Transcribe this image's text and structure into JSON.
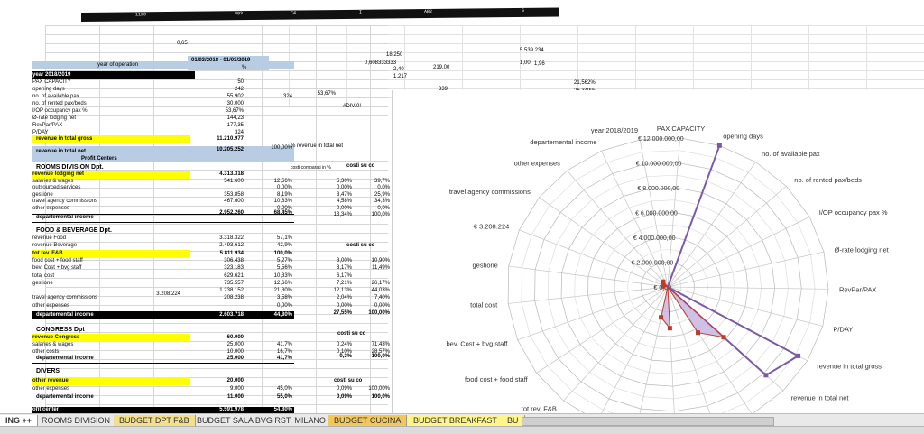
{
  "column_headers": [
    "1120",
    "893",
    "C4",
    "I",
    "",
    "",
    "AB2",
    "",
    "",
    "S"
  ],
  "top_cells": {
    "c1": "0,65",
    "c2": "18.250",
    "c3": "0,608333333",
    "c4": "2,40",
    "c5": "219,00",
    "c6": "1,00",
    "c7": "1,96",
    "c8": "1,217",
    "c9": "5.539.234",
    "c10": "339",
    "c11": "21,562%",
    "c12": "26,349%"
  },
  "header": {
    "year_of_operation": "year of operation",
    "period": "01/03/2018 - 01/03/2019",
    "pct": "%"
  },
  "kpi_rows": [
    {
      "label": "year 2018/2019",
      "v1": "",
      "v2": ""
    },
    {
      "label": "PAX CAPACITY",
      "v1": "50",
      "v2": ""
    },
    {
      "label": "opening days",
      "v1": "242",
      "v2": ""
    },
    {
      "label": "no. of available pax",
      "v1": "55.902",
      "v2": "324"
    },
    {
      "label": "no. of rented pax/beds",
      "v1": "30.000",
      "v2": ""
    },
    {
      "label": "I/OP occupancy pax %",
      "v1": "53,67%",
      "v2": ""
    },
    {
      "label": "Ø-rate lodging net",
      "v1": "144,23",
      "v2": ""
    },
    {
      "label": "RevPar/PAX",
      "v1": "177,35",
      "v2": ""
    },
    {
      "label": "P/DAY",
      "v1": "324",
      "v2": ""
    }
  ],
  "side_value_a": "53,67%",
  "side_value_b": "#DIV/0!",
  "revenue_gross": {
    "label": "revenue in total gross",
    "value": "11.210.977"
  },
  "revenue_net": {
    "label": "revenue in total net",
    "value": "10.205.252",
    "pct": "100,00%",
    "note": "% revenue in total net"
  },
  "profit_centers_label": "Profit Centers",
  "rooms": {
    "title": "ROOMS DIVISION Dpt.",
    "col_head_a": "costi comparati in %",
    "col_head_b": "costi su co",
    "rows": [
      {
        "label": "revenue lodging net",
        "v1": "4.313.318",
        "v2": "",
        "v3": "",
        "v4": "",
        "highlight": true
      },
      {
        "label": "salaries & wages",
        "v1": "541.600",
        "v2": "12,56%",
        "v3": "5,30%",
        "v4": "39,7%"
      },
      {
        "label": "outsourced services",
        "v1": "",
        "v2": "0,00%",
        "v3": "0,00%",
        "v4": "0,0%"
      },
      {
        "label": "gestione",
        "v1": "353.858",
        "v2": "8,19%",
        "v3": "3,47%",
        "v4": "25,9%"
      },
      {
        "label": "travel agency commissions",
        "v1": "467.600",
        "v2": "10,83%",
        "v3": "4,58%",
        "v4": "34,3%"
      },
      {
        "label": "other expenses",
        "v1": "",
        "v2": "0,00%",
        "v3": "0,00%",
        "v4": "0,0%"
      },
      {
        "label": "",
        "v1": "",
        "v2": "",
        "v3": "13,34%",
        "v4": "100,0%"
      }
    ],
    "dept_income": {
      "label": "departemental income",
      "v1": "2.952.260",
      "v2": "68,45%"
    }
  },
  "fnb": {
    "title": "FOOD & BEVERAGE Dpt.",
    "col_head": "costi su co",
    "rows": [
      {
        "label": "revenue Food",
        "v1": "3.318.322",
        "v2": "57,1%",
        "v3": "",
        "v4": ""
      },
      {
        "label": "revenue Beverage",
        "v1": "2.493.612",
        "v2": "42,9%",
        "v3": "",
        "v4": ""
      },
      {
        "label": "tot rev. F&B",
        "v1": "5.811.934",
        "v2": "100,0%",
        "v3": "",
        "v4": "",
        "highlight": true
      },
      {
        "label": "food cost + food staff",
        "v1": "306.438",
        "v2": "5,27%",
        "v3": "3,00%",
        "v4": "10,90%"
      },
      {
        "label": "bev. Cost + bvg staff",
        "v1": "323.183",
        "v2": "5,56%",
        "v3": "3,17%",
        "v4": "11,49%"
      },
      {
        "label": "total cost",
        "v1": "629.621",
        "v2": "10,83%",
        "v3": "6,17%",
        "v4": ""
      },
      {
        "label": "gestione",
        "v1": "735.557",
        "v2": "12,66%",
        "v3": "7,21%",
        "v4": "26,17%"
      },
      {
        "label": "",
        "v1": "1.238.152",
        "v2": "21,30%",
        "v3": "12,13%",
        "v4": "44,03%"
      },
      {
        "label": "travel agency commissions",
        "v1": "208.238",
        "v2": "3,58%",
        "v3": "2,04%",
        "v4": "7,40%"
      },
      {
        "label": "other expenses",
        "v1": "",
        "v2": "0,00%",
        "v3": "0,00%",
        "v4": "0,00%"
      }
    ],
    "side_amount": "3.208.224",
    "dept_income": {
      "label": "departemental income",
      "v1": "2.603.718",
      "v2": "44,80%",
      "v3": "27,55%",
      "v4": "100,00%"
    }
  },
  "congress": {
    "title": "CONGRESS Dpt",
    "col_head": "costi su co",
    "rows": [
      {
        "label": "revenue Congress",
        "v1": "60.000",
        "v2": "",
        "v3": "",
        "v4": "",
        "highlight": true
      },
      {
        "label": "salaries & wages",
        "v1": "25.000",
        "v2": "41,7%",
        "v3": "0,24%",
        "v4": "71,43%"
      },
      {
        "label": "other costs",
        "v1": "10.000",
        "v2": "16,7%",
        "v3": "0,10%",
        "v4": "28,57%"
      }
    ],
    "dept_income": {
      "label": "departemental income",
      "v1": "25.000",
      "v2": "41,7%",
      "v3": "0,3%",
      "v4": "100,0%"
    }
  },
  "divers": {
    "title": "DIVERS",
    "col_head": "costi su co",
    "rows": [
      {
        "label": "other revenue",
        "v1": "20.000",
        "v2": "",
        "v3": "",
        "v4": "",
        "highlight": true
      },
      {
        "label": "other expenses",
        "v1": "9.000",
        "v2": "45,0%",
        "v3": "0,09%",
        "v4": "100,00%"
      }
    ],
    "dept_income": {
      "label": "departemental income",
      "v1": "11.000",
      "v2": "55,0%",
      "v3": "0,09%",
      "v4": "100,0%"
    }
  },
  "footer_row": {
    "label": "dept. Inc. profit center",
    "v1": "5.591.978",
    "v2": "54,80%"
  },
  "chart_data": {
    "type": "radar",
    "title": "",
    "radial_ticks": [
      "€ 0,00",
      "€ 2.000.000,00",
      "€ 4.000.000,00",
      "€ 6.000.000,00",
      "€ 8.000.000,00",
      "€ 10.000.000,00",
      "€ 12.000.000,00"
    ],
    "rmax": 12000000,
    "categories": [
      "year 2018/2019",
      "PAX CAPACITY",
      "opening days",
      "no. of available pax",
      "no. of rented pax/beds",
      "I/OP occupancy pax %",
      "Ø-rate lodging net",
      "RevPar/PAX",
      "P/DAY",
      "revenue in total gross",
      "revenue in total net",
      "Profit Centers",
      "",
      "",
      "revenue Food",
      "revenue Beverage",
      "tot rev. F&B",
      "food cost + food staff",
      "bev. Cost + bvg staff",
      "total cost",
      "gestione",
      "€ 3.208.224",
      "travel agency commissions",
      "other expenses",
      "departemental income"
    ],
    "series": [
      {
        "values": [
          0,
          0,
          12000000,
          0,
          0,
          0,
          0,
          0,
          0,
          11210977,
          10205252,
          0,
          0,
          0,
          0,
          0,
          0,
          0,
          0,
          0,
          0,
          0,
          0,
          0,
          0
        ]
      },
      {
        "values": [
          0,
          0,
          0,
          0,
          0,
          0,
          0,
          0,
          0,
          0,
          5811934,
          4313318,
          0,
          3318322,
          2493612,
          0,
          0,
          0,
          0,
          0,
          353858,
          0,
          467600,
          541600,
          0
        ]
      }
    ]
  },
  "sheet_tabs": [
    "ING ++",
    "ROOMS DIVISION",
    "BUDGET DPT F&B",
    "BUDGET SALA BVG RST. MILANO",
    "BUDGET CUCINA",
    "BUDGET BREAKFAST",
    "BU"
  ],
  "active_tab": "ING ++",
  "colors": {
    "accent_yellow": "#ffff00",
    "header_blue": "#b8cce4",
    "series_purple": "#7a5aa8",
    "series_red": "#c0392b",
    "fill_lavender": "#c8b6e2"
  }
}
